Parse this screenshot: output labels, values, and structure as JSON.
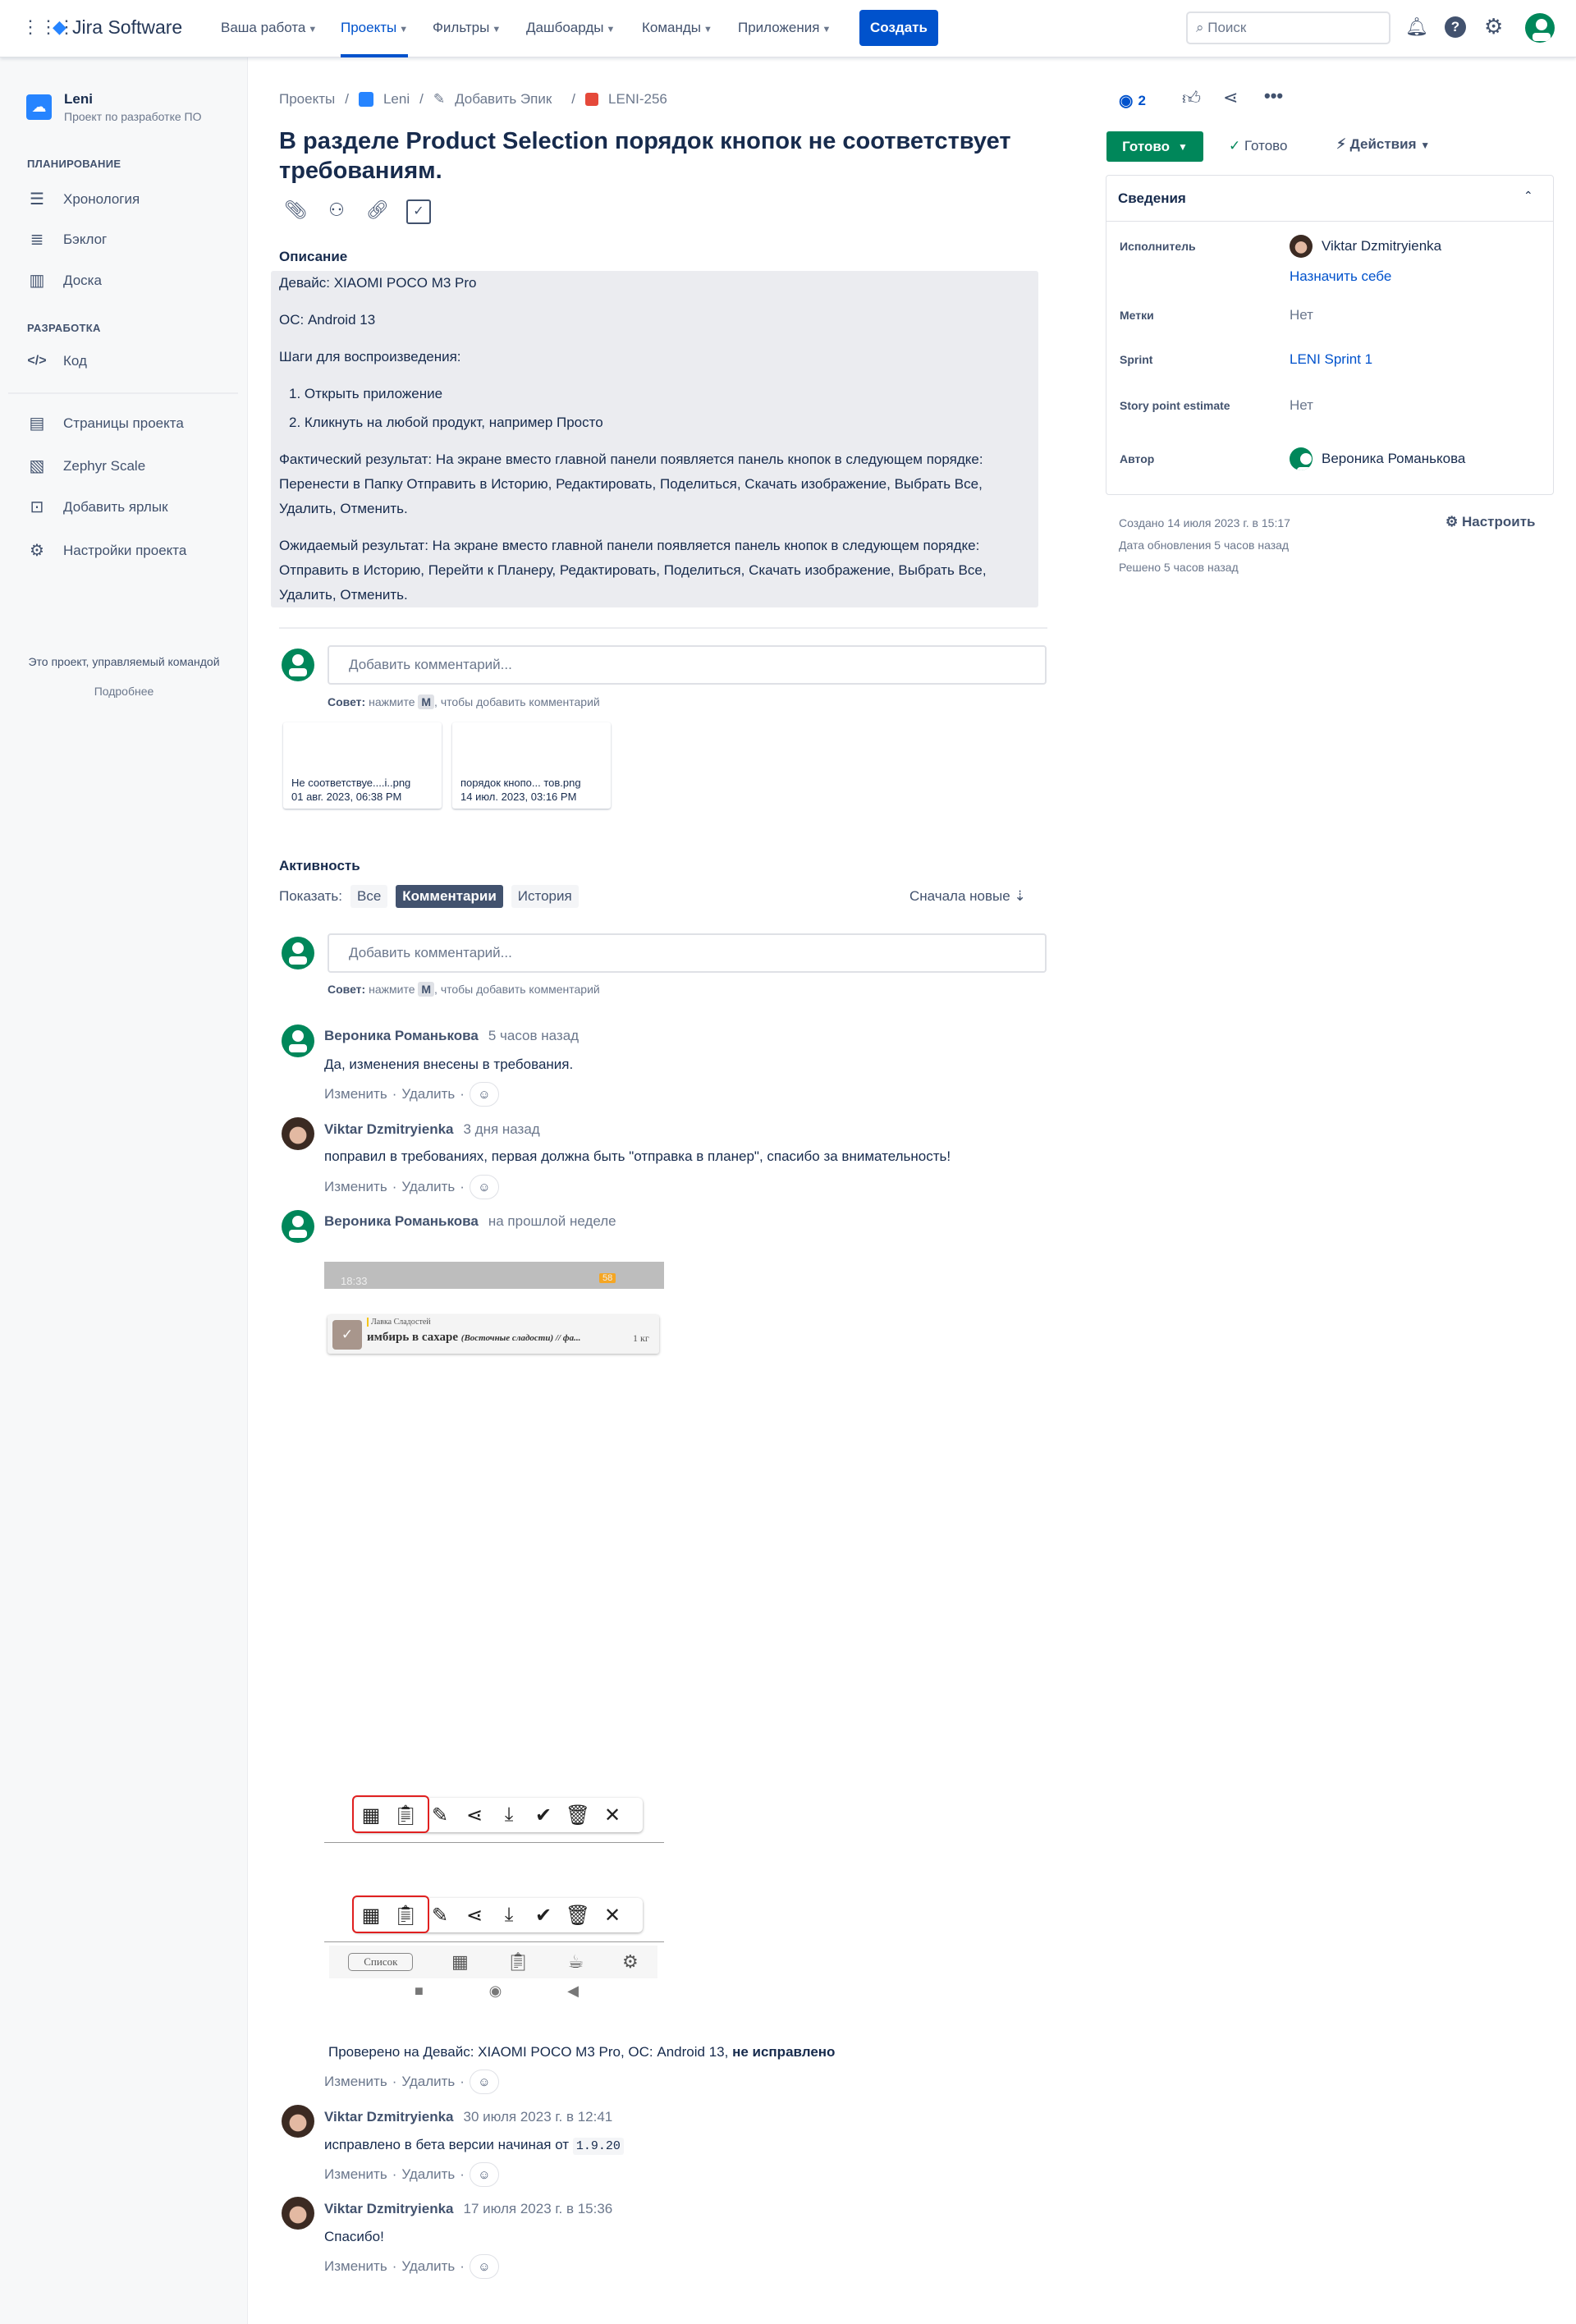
{
  "topnav": {
    "app_name": "Jira Software",
    "items": [
      "Ваша работа",
      "Проекты",
      "Фильтры",
      "Дашбоарды",
      "Команды",
      "Приложения"
    ],
    "active": "Проекты",
    "create_label": "Создать",
    "search_placeholder": "Поиск"
  },
  "sidebar": {
    "project_name": "Leni",
    "project_type": "Проект по разработке ПО",
    "section_planning": "ПЛАНИРОВАНИЕ",
    "planning_items": [
      "Хронология",
      "Бэклог",
      "Доска"
    ],
    "section_dev": "РАЗРАБОТКА",
    "dev_items": [
      "Код"
    ],
    "other_items": [
      "Страницы проекта",
      "Zephyr Scale",
      "Добавить ярлык",
      "Настройки проекта"
    ],
    "footer_text": "Это проект, управляемый командой",
    "footer_link": "Подробнее"
  },
  "breadcrumb": [
    "Проекты",
    "Leni",
    "Добавить Эпик",
    "LENI-256"
  ],
  "issue": {
    "title": "В разделе Product Selection порядок кнопок не соответствует требованиям.",
    "description_label": "Описание",
    "description": [
      "Девайс: XIAOMI POCO M3 Pro",
      "ОС: Android 13",
      "Шаги для воспроизведения:",
      "1. Открыть приложение",
      "2. Кликнуть на любой продукт, например Просто",
      "Фактический результат: На экране вместо главной панели появляется панель кнопок в следующем порядке:",
      "Перенести в Папку Отправить в Историю, Редактировать, Поделиться, Скачать изображение, Выбрать Все,",
      "Удалить, Отменить.",
      "Ожидаемый результат: На экране вместо главной панели появляется панель кнопок в следующем порядке:",
      "Отправить в Историю, Перейти к Планеру,  Редактировать, Поделиться, Скачать изображение, Выбрать Все,",
      "Удалить, Отменить."
    ]
  },
  "comment_box": {
    "placeholder": "Добавить комментарий...",
    "tip_bold": "Совет:",
    "tip_pre": "нажмите",
    "tip_key": "M",
    "tip_post": ", чтобы добавить комментарий"
  },
  "attachments": [
    {
      "name": "Не соответствуе....i..png",
      "date": "01 авг. 2023, 06:38 PM"
    },
    {
      "name": "порядок кнопо...  тов.png",
      "date": "14 июл. 2023, 03:16 PM"
    }
  ],
  "activity": {
    "title": "Активность",
    "show_label": "Показать:",
    "tabs": [
      "Все",
      "Комментарии",
      "История"
    ],
    "active_tab": "Комментарии",
    "sort_label": "Сначала новые"
  },
  "comment_actions": {
    "edit": "Изменить",
    "delete": "Удалить"
  },
  "comments": [
    {
      "author": "Вероника Романькова",
      "time": "5 часов назад",
      "text": "Да, изменения внесены в требования."
    },
    {
      "author": "Viktar Dzmitryienka",
      "time": "3 дня назад",
      "text": "поправил в требованиях, первая должна быть \"отправка в планер\", спасибо за внимательность!"
    },
    {
      "author": "Вероника Романькова",
      "time": "на прошлой неделе",
      "text": "Проверено на Девайс: XIAOMI POCO M3 Pro, ОС: Android 13,",
      "text_bold": "не исправлено",
      "screenshot": {
        "status_time": "18:33",
        "battery": "58",
        "shop": "Лавка Сладостей",
        "product": "имбирь в сахаре",
        "product_sub": "(Восточные сладости) // фа...",
        "weight": "1 кг",
        "list_label": "Список"
      }
    },
    {
      "author": "Viktar Dzmitryienka",
      "time": "30 июля 2023 г. в 12:41",
      "text": "исправлено в бета версии начиная от",
      "code": "1.9.20"
    },
    {
      "author": "Viktar Dzmitryienka",
      "time": "17 июля 2023 г. в 15:36",
      "text": "Спасибо!"
    }
  ],
  "right": {
    "watchers": "2",
    "status_button": "Готово",
    "resolution": "Готово",
    "actions_label": "Действия",
    "details_title": "Сведения",
    "fields": {
      "assignee_label": "Исполнитель",
      "assignee": "Viktar Dzmitryienka",
      "assign_self": "Назначить себе",
      "labels_label": "Метки",
      "labels": "Нет",
      "sprint_label": "Sprint",
      "sprint": "LENI Sprint 1",
      "sp_label": "Story point estimate",
      "sp": "Нет",
      "reporter_label": "Автор",
      "reporter": "Вероника Романькова"
    },
    "created": "Создано 14 июля 2023 г. в 15:17",
    "updated": "Дата обновления 5 часов назад",
    "resolved": "Решено 5 часов назад",
    "configure": "Настроить"
  },
  "colors": {
    "brand": "#0052cc",
    "success": "#00875a",
    "text": "#172b4d"
  }
}
